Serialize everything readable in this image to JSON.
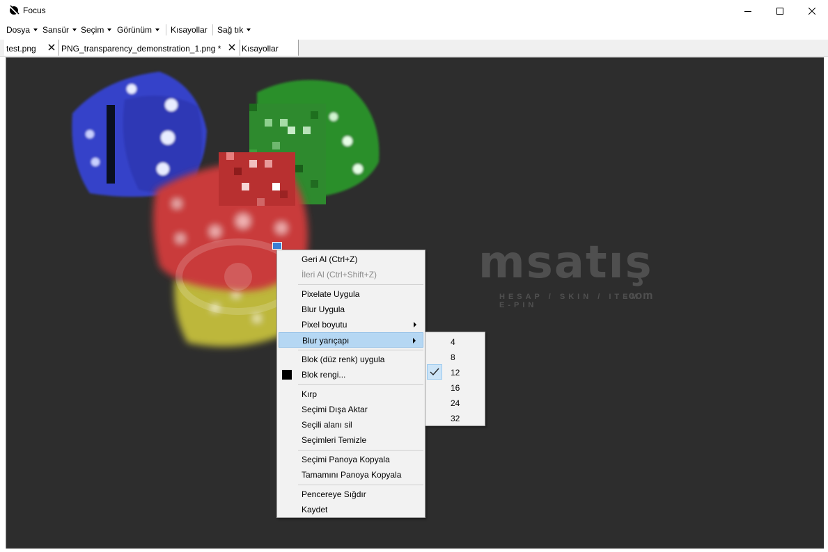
{
  "window": {
    "title": "Focus",
    "icon": "focus-logo-icon",
    "buttons": [
      "minimize-icon",
      "maximize-icon",
      "close-icon"
    ]
  },
  "menubar": {
    "items": [
      {
        "label": "Dosya",
        "dropdown": true
      },
      {
        "label": "Sansür",
        "dropdown": true
      },
      {
        "label": "Seçim",
        "dropdown": true
      },
      {
        "label": "Görünüm",
        "dropdown": true
      },
      {
        "label": "Kısayollar",
        "dropdown": false
      },
      {
        "label": "Sağ tık",
        "dropdown": true
      }
    ]
  },
  "tabs": [
    {
      "label": "test.png",
      "closable": true
    },
    {
      "label": "PNG_transparency_demonstration_1.png *",
      "closable": true,
      "active": true
    },
    {
      "label": "Kısayollar",
      "closable": false
    }
  ],
  "watermark": {
    "text": "msatış",
    "subtext": "HESAP / SKIN / ITEM / E-PIN",
    "suffix": ".com"
  },
  "context_menu": {
    "items": [
      {
        "label": "Geri Al (Ctrl+Z)",
        "disabled": false
      },
      {
        "label": "İleri Al (Ctrl+Shift+Z)",
        "disabled": true
      },
      {
        "label": "Pixelate Uygula"
      },
      {
        "label": "Blur Uygula"
      },
      {
        "label": "Pixel boyutu",
        "submenu": true
      },
      {
        "label": "Blur yarıçapı",
        "submenu": true,
        "highlighted": true
      },
      {
        "label": "Blok (düz renk) uygula"
      },
      {
        "label": "Blok rengi...",
        "swatch": "#000000"
      },
      {
        "label": "Kırp"
      },
      {
        "label": "Seçimi Dışa Aktar"
      },
      {
        "label": "Seçili alanı sil"
      },
      {
        "label": "Seçimleri Temizle"
      },
      {
        "label": "Seçimi Panoya Kopyala"
      },
      {
        "label": "Tamamını Panoya Kopyala"
      },
      {
        "label": "Pencereye Sığdır"
      },
      {
        "label": "Kaydet"
      }
    ]
  },
  "blur_submenu": {
    "options": [
      "4",
      "8",
      "12",
      "16",
      "24",
      "32"
    ],
    "selected": "12"
  },
  "colors": {
    "canvas_bg": "#2d2d2d",
    "highlight": "#b5d7f3",
    "dice": [
      "#3b4bd0",
      "#2e9a2e",
      "#c93a3a",
      "#c9c33a"
    ]
  }
}
